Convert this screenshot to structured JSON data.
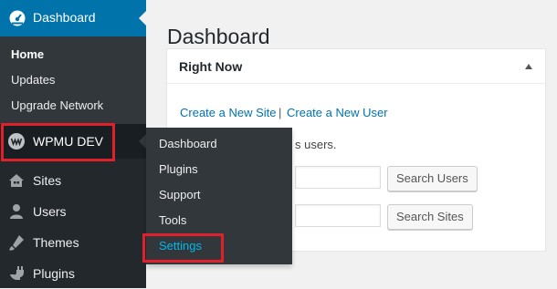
{
  "sidebar": {
    "dashboard_label": "Dashboard",
    "submenu": [
      "Home",
      "Updates",
      "Upgrade Network"
    ],
    "wpmu_label": "WPMU DEV",
    "items": [
      {
        "label": "Sites",
        "icon": "sites-icon"
      },
      {
        "label": "Users",
        "icon": "users-icon"
      },
      {
        "label": "Themes",
        "icon": "themes-icon"
      },
      {
        "label": "Plugins",
        "icon": "plugins-icon"
      }
    ]
  },
  "flyout": {
    "items": [
      "Dashboard",
      "Plugins",
      "Support",
      "Tools",
      "Settings"
    ],
    "active": "Settings"
  },
  "main": {
    "title": "Dashboard",
    "panel": {
      "title": "Right Now",
      "link_site": "Create a New Site",
      "separator": "|",
      "link_user": "Create a New User",
      "status_text": "s users.",
      "search_users_label": "Search Users",
      "search_sites_label": "Search Sites"
    }
  },
  "colors": {
    "sidebar_bg": "#23282d",
    "accent": "#0073aa",
    "highlight": "#00b9eb",
    "annotation": "#e0202a"
  }
}
